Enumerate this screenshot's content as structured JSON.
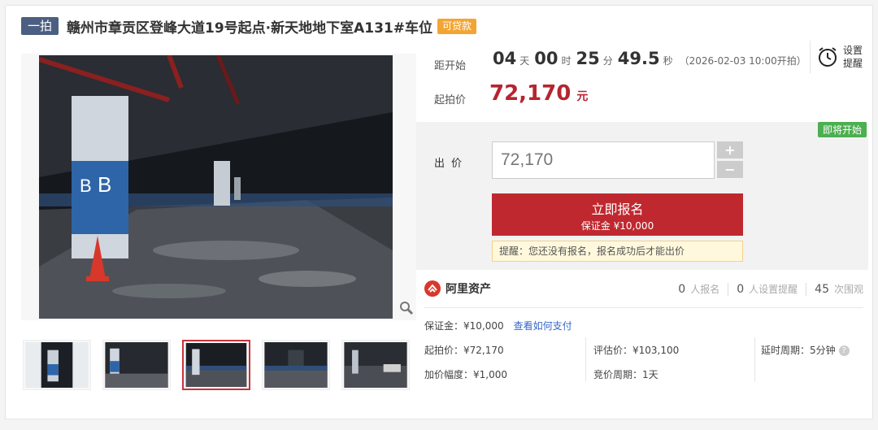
{
  "header": {
    "round_badge": "一拍",
    "title": "赣州市章贡区登峰大道19号起点·新天地地下室A131#车位",
    "loan_badge": "可贷款"
  },
  "countdown": {
    "label": "距开始",
    "days": "04",
    "days_unit": "天",
    "hours": "00",
    "hours_unit": "时",
    "minutes": "25",
    "minutes_unit": "分",
    "seconds": "49.5",
    "seconds_unit": "秒",
    "start_time": "（2026-02-03 10:00开拍）"
  },
  "reminder": {
    "line1": "设置",
    "line2": "提醒",
    "icon": "alarm-clock-icon"
  },
  "start_price": {
    "label": "起拍价",
    "value": "72,170",
    "unit": "元"
  },
  "bid": {
    "status_badge": "即将开始",
    "label": "出价",
    "value": "72,170",
    "plus": "+",
    "minus": "−",
    "signup_label": "立即报名",
    "deposit_sub": "保证金 ¥10,000",
    "tip": "提醒：您还没有报名，报名成功后才能出价"
  },
  "platform": {
    "name": "阿里资产",
    "signups": "0",
    "signups_label": "人报名",
    "reminders": "0",
    "reminders_label": "人设置提醒",
    "views": "45",
    "views_label": "次围观"
  },
  "details": {
    "deposit": "保证金：¥10,000",
    "pay_link": "查看如何支付",
    "start_price": "起拍价：¥72,170",
    "increment": "加价幅度：¥1,000",
    "appraisal": "评估价：¥103,100",
    "bid_period": "竞价周期：1天",
    "delay_period": "延时周期：5分钟"
  },
  "colors": {
    "accent_red": "#c0282f",
    "price_red": "#b5252f",
    "badge_navy": "#4b5f82",
    "loan_orange": "#f3a533",
    "status_green": "#4caf50",
    "link_blue": "#3366cc"
  }
}
